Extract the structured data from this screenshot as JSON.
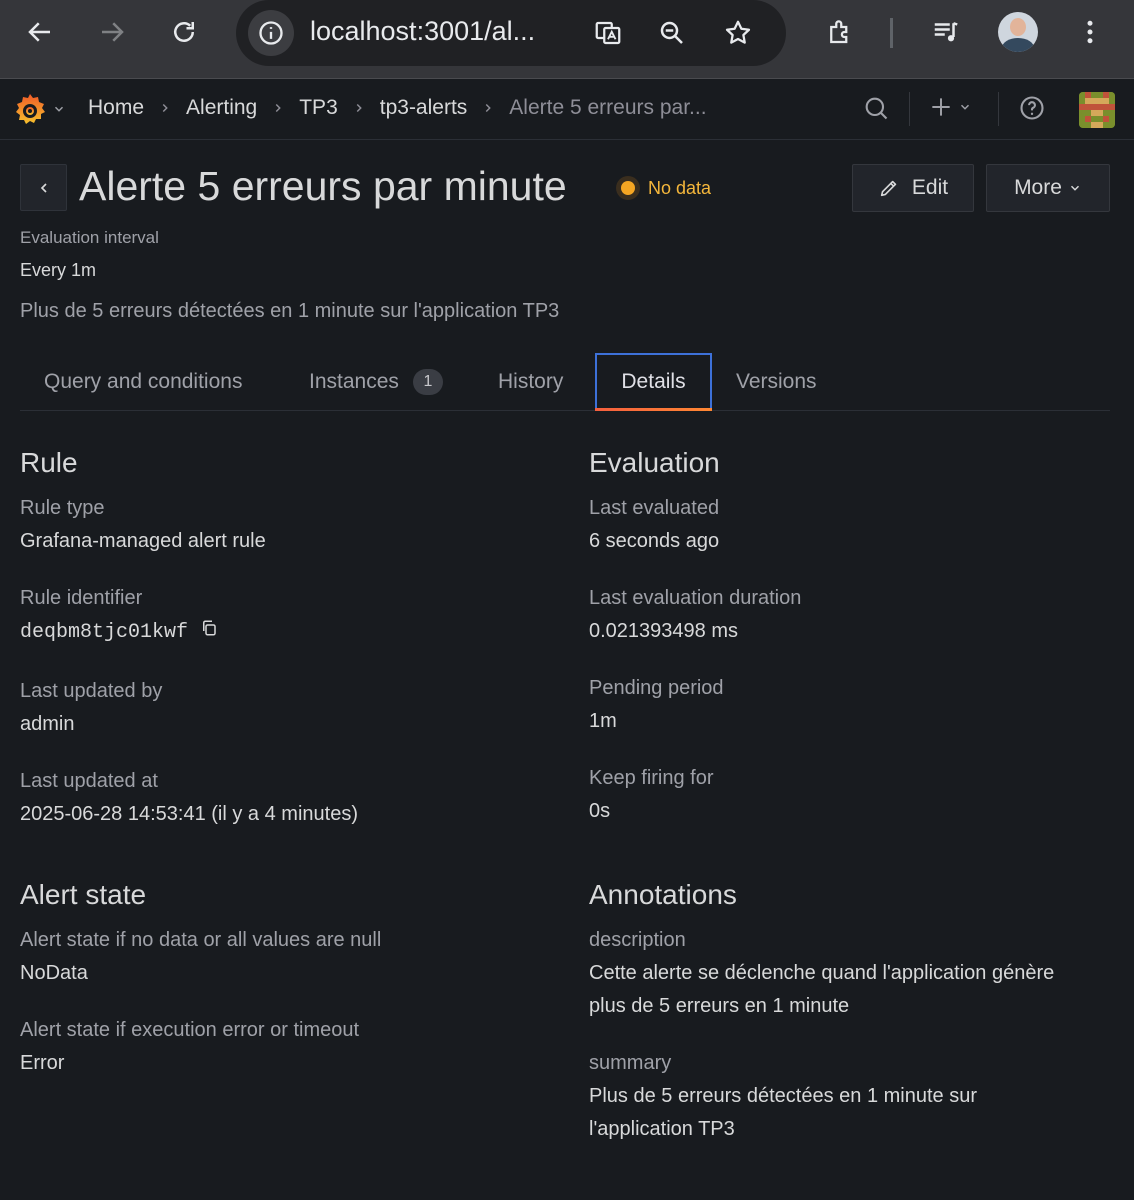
{
  "browser": {
    "url": "localhost:3001/al..."
  },
  "topbar": {
    "breadcrumbs": [
      "Home",
      "Alerting",
      "TP3",
      "tp3-alerts",
      "Alerte 5 erreurs par..."
    ]
  },
  "header": {
    "title": "Alerte 5 erreurs par minute",
    "state": "No data",
    "edit_label": "Edit",
    "more_label": "More",
    "eval_interval_label": "Evaluation interval",
    "eval_interval_value": "Every 1m",
    "description": "Plus de 5 erreurs détectées en 1 minute sur l'application TP3"
  },
  "tabs": [
    {
      "label": "Query and conditions"
    },
    {
      "label": "Instances",
      "count": "1"
    },
    {
      "label": "History"
    },
    {
      "label": "Details"
    },
    {
      "label": "Versions"
    }
  ],
  "rule": {
    "heading": "Rule",
    "type_label": "Rule type",
    "type_value": "Grafana-managed alert rule",
    "identifier_label": "Rule identifier",
    "identifier_value": "deqbm8tjc01kwf",
    "updated_by_label": "Last updated by",
    "updated_by_value": "admin",
    "updated_at_label": "Last updated at",
    "updated_at_value": "2025-06-28 14:53:41 (il y a 4 minutes)"
  },
  "evaluation": {
    "heading": "Evaluation",
    "last_evaluated_label": "Last evaluated",
    "last_evaluated_value": "6 seconds ago",
    "duration_label": "Last evaluation duration",
    "duration_value": "0.021393498 ms",
    "pending_label": "Pending period",
    "pending_value": "1m",
    "keep_firing_label": "Keep firing for",
    "keep_firing_value": "0s"
  },
  "alert_state": {
    "heading": "Alert state",
    "nodata_label": "Alert state if no data or all values are null",
    "nodata_value": "NoData",
    "error_label": "Alert state if execution error or timeout",
    "error_value": "Error"
  },
  "annotations": {
    "heading": "Annotations",
    "description_label": "description",
    "description_value": "Cette alerte se déclenche quand l'application génère plus de 5 erreurs en 1 minute",
    "summary_label": "summary",
    "summary_value": "Plus de 5 erreurs détectées en 1 minute sur l'application TP3"
  },
  "colors": {
    "state_accent": "#f5a623",
    "active_tab_border": "#3d71d9",
    "active_tab_underline": "#ff8833"
  }
}
